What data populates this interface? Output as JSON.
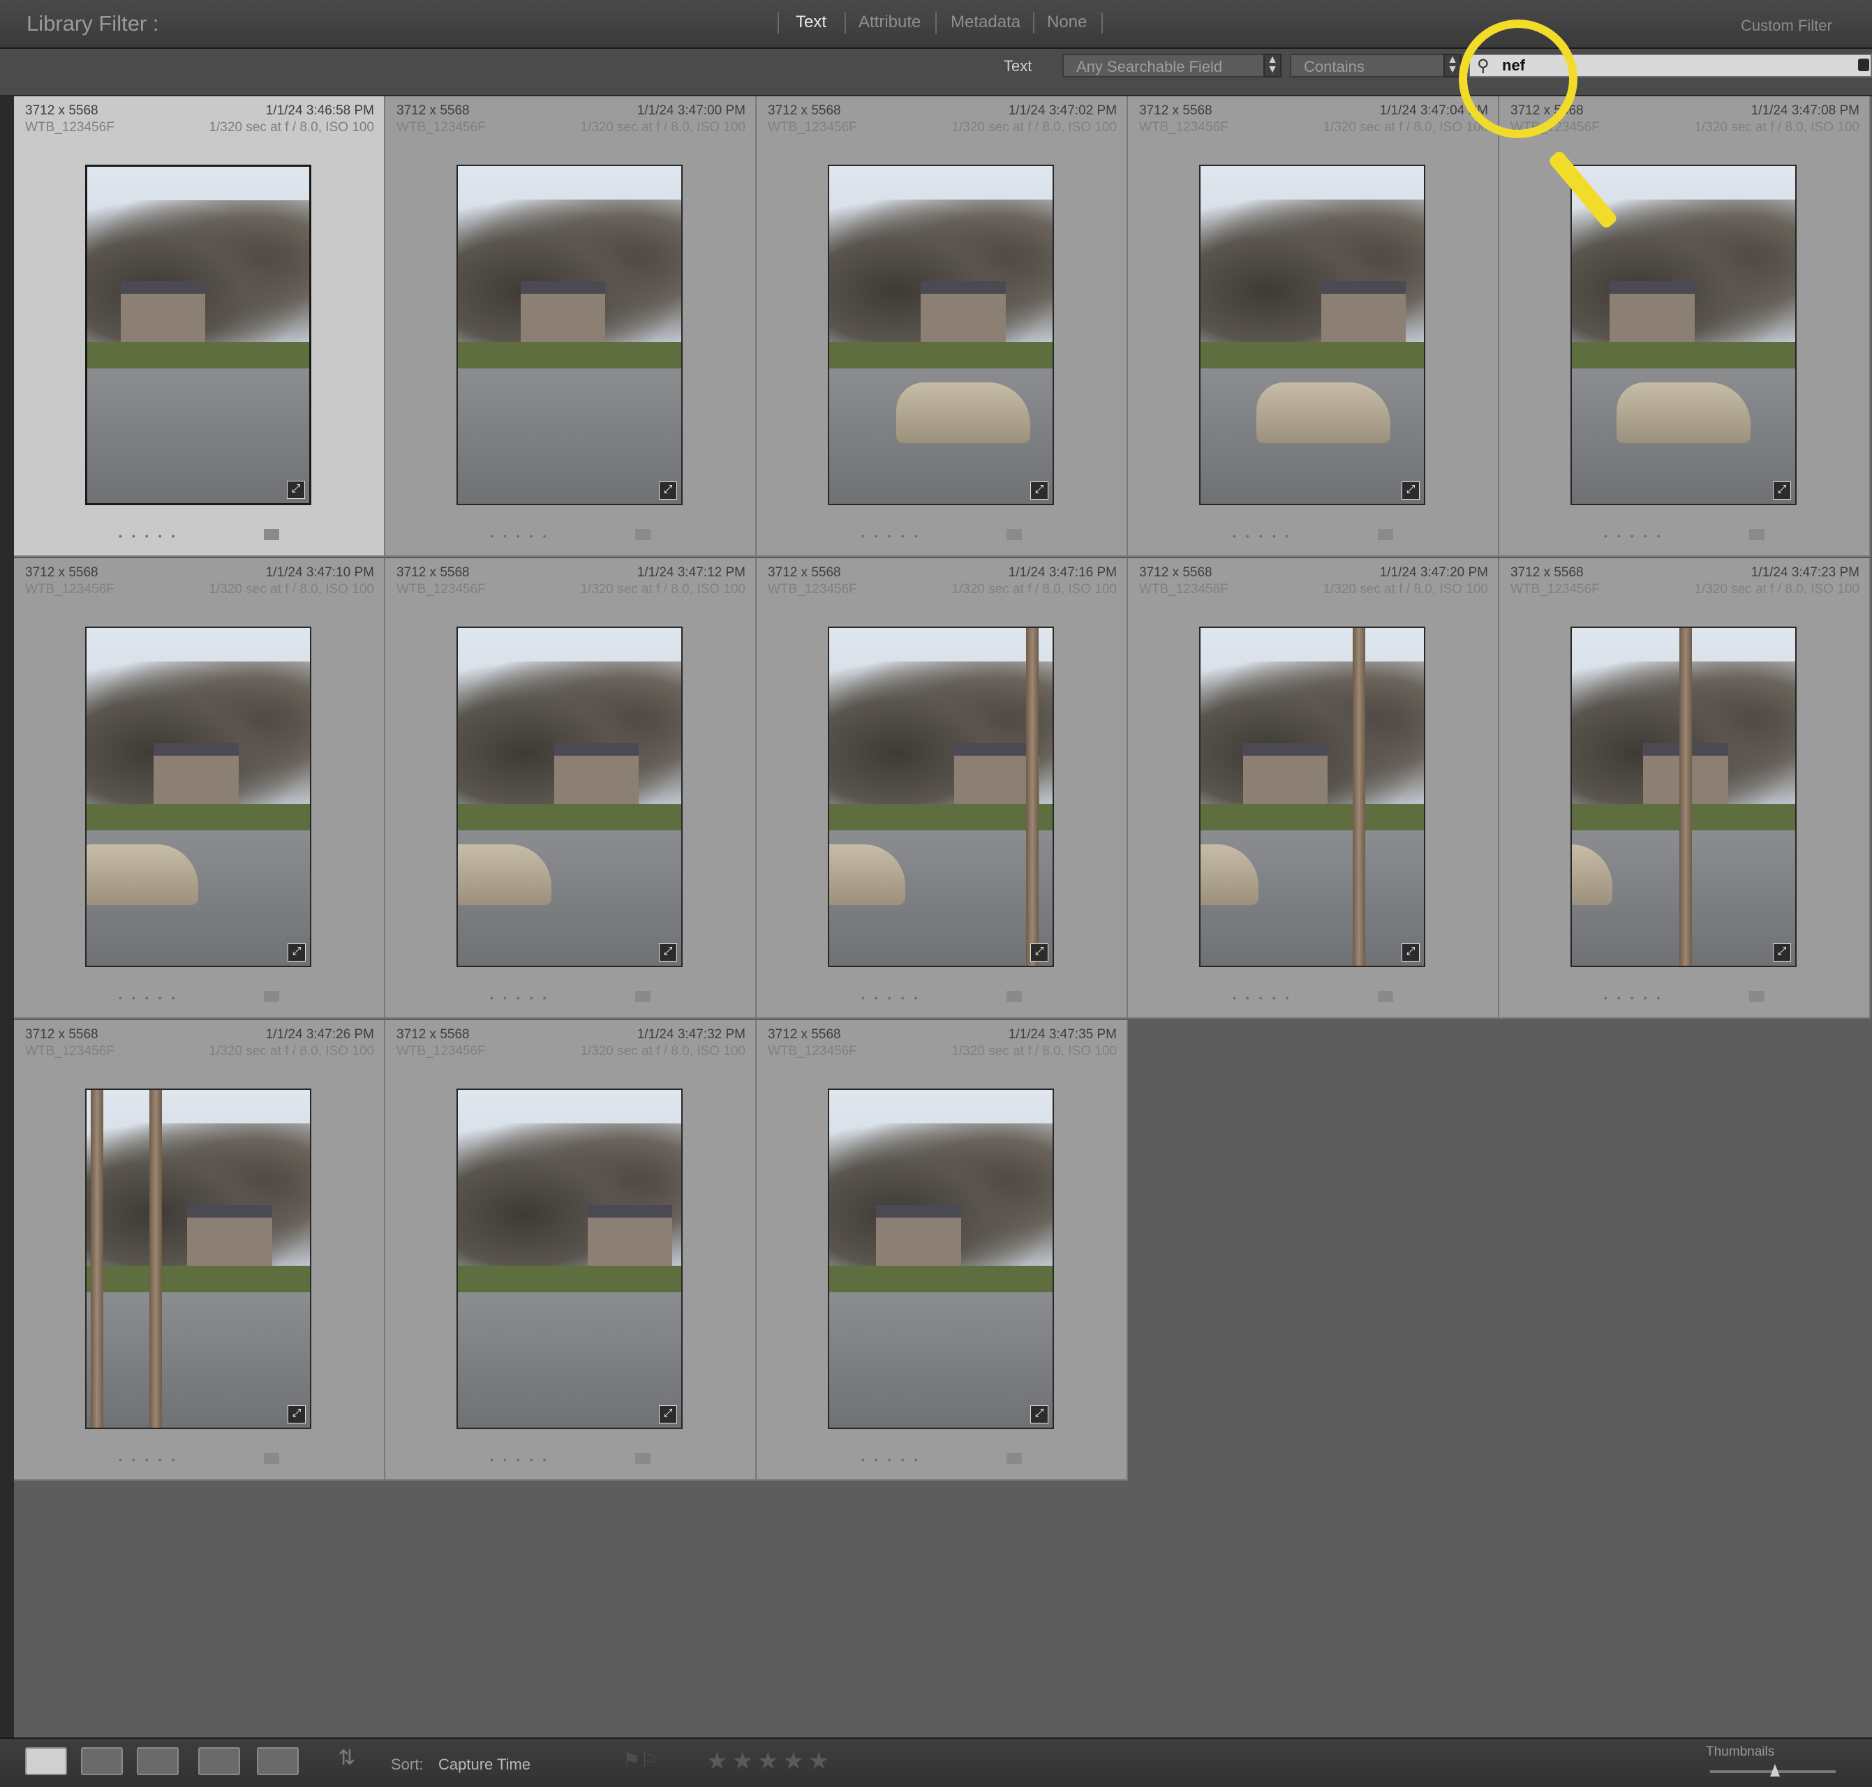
{
  "filter_bar": {
    "title": "Library Filter :",
    "tabs": [
      "Text",
      "Attribute",
      "Metadata",
      "None"
    ],
    "active_tab": "Text",
    "custom_filter": "Custom Filter"
  },
  "text_filter": {
    "label": "Text",
    "field_dropdown": "Any Searchable Field",
    "rule_dropdown": "Contains",
    "search_value": "nef"
  },
  "grid": {
    "cells": [
      {
        "dims": "3712 x 5568",
        "date": "1/1/24 3:46:58 PM",
        "file": "WTB_123456F",
        "exposure": "1/320 sec at f / 8.0, ISO 100"
      },
      {
        "dims": "3712 x 5568",
        "date": "1/1/24 3:47:00 PM",
        "file": "WTB_123456F",
        "exposure": "1/320 sec at f / 8.0, ISO 100"
      },
      {
        "dims": "3712 x 5568",
        "date": "1/1/24 3:47:02 PM",
        "file": "WTB_123456F",
        "exposure": "1/320 sec at f / 8.0, ISO 100"
      },
      {
        "dims": "3712 x 5568",
        "date": "1/1/24 3:47:04 PM",
        "file": "WTB_123456F",
        "exposure": "1/320 sec at f / 8.0, ISO 100"
      },
      {
        "dims": "3712 x 5568",
        "date": "1/1/24 3:47:08 PM",
        "file": "WTB_123456F",
        "exposure": "1/320 sec at f / 8.0, ISO 100"
      },
      {
        "dims": "3712 x 5568",
        "date": "1/1/24 3:47:10 PM",
        "file": "WTB_123456F",
        "exposure": "1/320 sec at f / 8.0, ISO 100"
      },
      {
        "dims": "3712 x 5568",
        "date": "1/1/24 3:47:12 PM",
        "file": "WTB_123456F",
        "exposure": "1/320 sec at f / 8.0, ISO 100"
      },
      {
        "dims": "3712 x 5568",
        "date": "1/1/24 3:47:16 PM",
        "file": "WTB_123456F",
        "exposure": "1/320 sec at f / 8.0, ISO 100"
      },
      {
        "dims": "3712 x 5568",
        "date": "1/1/24 3:47:20 PM",
        "file": "WTB_123456F",
        "exposure": "1/320 sec at f / 8.0, ISO 100"
      },
      {
        "dims": "3712 x 5568",
        "date": "1/1/24 3:47:23 PM",
        "file": "WTB_123456F",
        "exposure": "1/320 sec at f / 8.0, ISO 100"
      },
      {
        "dims": "3712 x 5568",
        "date": "1/1/24 3:47:26 PM",
        "file": "WTB_123456F",
        "exposure": "1/320 sec at f / 8.0, ISO 100"
      },
      {
        "dims": "3712 x 5568",
        "date": "1/1/24 3:47:32 PM",
        "file": "WTB_123456F",
        "exposure": "1/320 sec at f / 8.0, ISO 100"
      },
      {
        "dims": "3712 x 5568",
        "date": "1/1/24 3:47:35 PM",
        "file": "WTB_123456F",
        "exposure": "1/320 sec at f / 8.0, ISO 100"
      }
    ]
  },
  "toolbar": {
    "sort_label": "Sort:",
    "sort_value": "Capture Time",
    "thumbnails_label": "Thumbnails"
  },
  "colors": {
    "annotation": "#f2dc2a",
    "selected_cell": "#c9c9c9",
    "cell": "#9c9c9c"
  }
}
